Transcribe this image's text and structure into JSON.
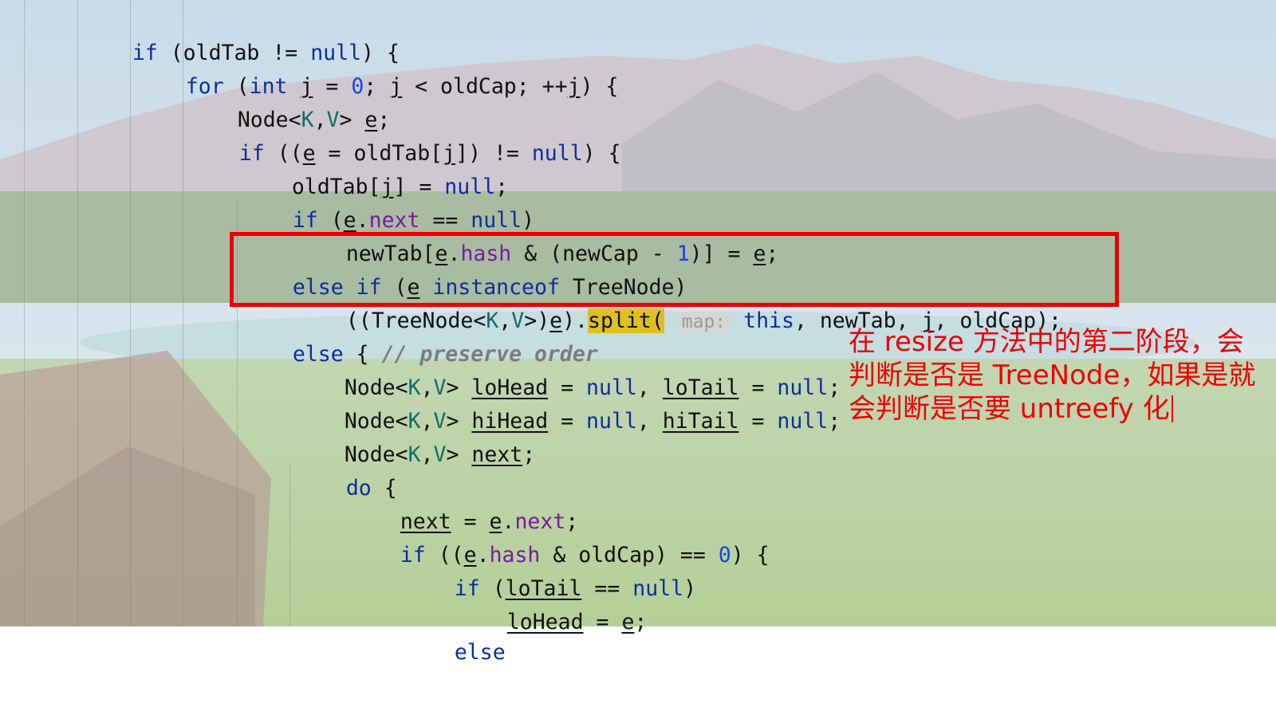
{
  "code": {
    "lines": [
      "if (oldTab != null) {",
      "for (int j = 0; j < oldCap; ++j) {",
      "Node<K,V> e;",
      "if ((e = oldTab[j]) != null) {",
      "oldTab[j] = null;",
      "if (e.next == null)",
      "newTab[e.hash & (newCap - 1)] = e;",
      "else if (e instanceof TreeNode)",
      "((TreeNode<K,V>)e).split( map: this, newTab, j, oldCap);",
      "else { // preserve order",
      "Node<K,V> loHead = null, loTail = null;",
      "Node<K,V> hiHead = null, hiTail = null;",
      "Node<K,V> next;",
      "do {",
      "next = e.next;",
      "if ((e.hash & oldCap) == 0) {",
      "if (loTail == null)",
      "loHead = e;",
      "else"
    ],
    "param_hint": "map:"
  },
  "annotation": {
    "text": "在 resize 方法中的第二阶段，会判断是否是 TreeNode，如果是就会判断是否要 untreefy 化"
  },
  "colors": {
    "keyword": "#0b2f9c",
    "type_param": "#0f6f66",
    "field": "#7b1aa0",
    "number": "#1845e6",
    "highlight": "#e0c021",
    "annotation_red": "#ee0000"
  }
}
